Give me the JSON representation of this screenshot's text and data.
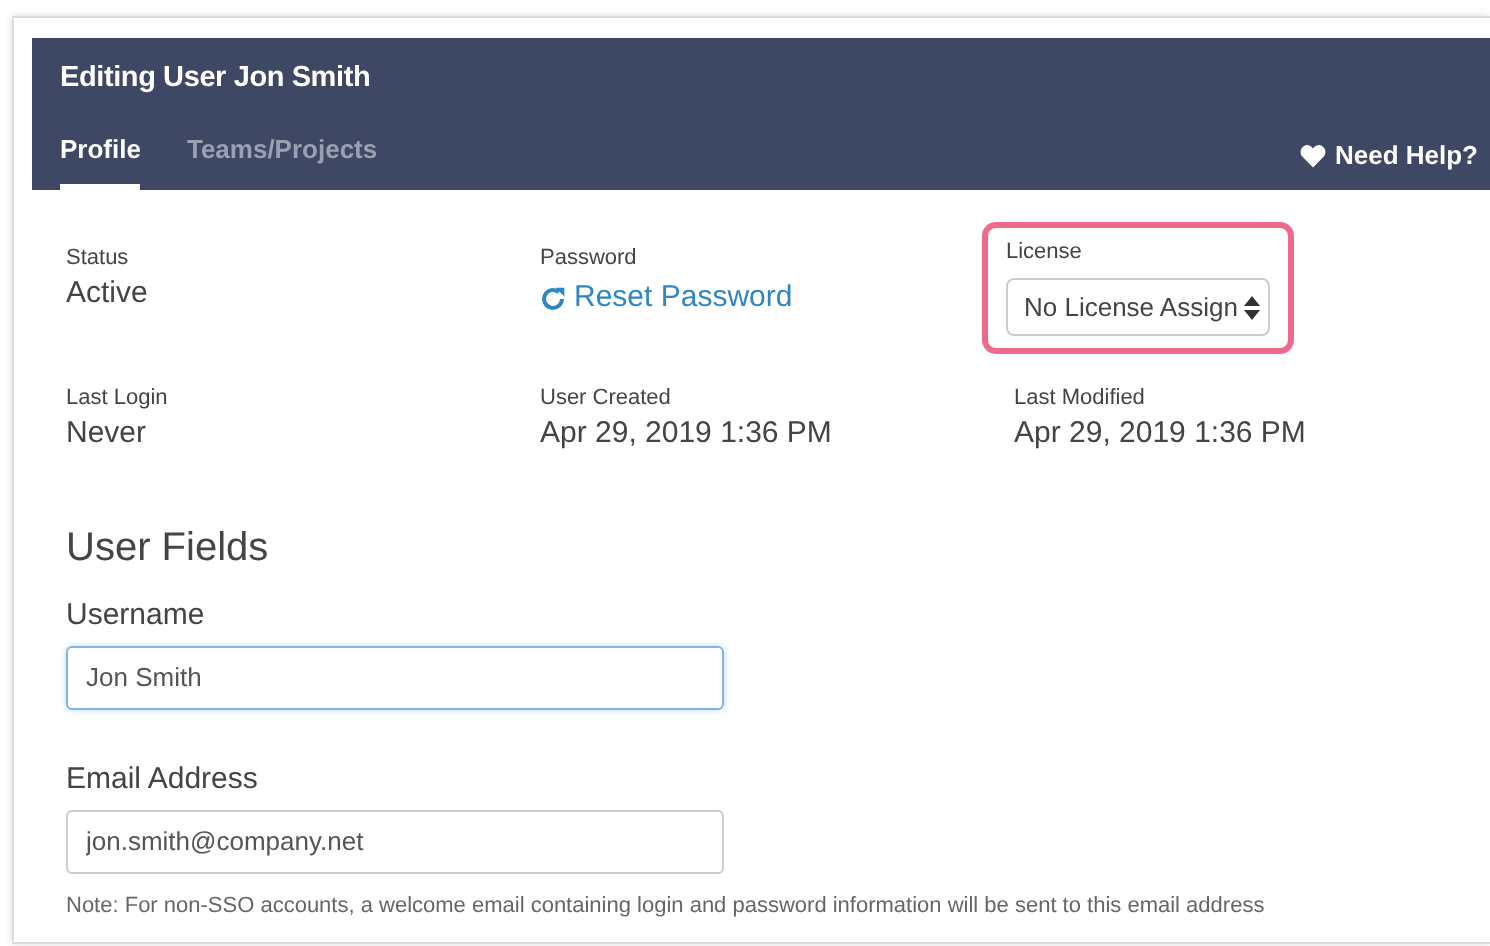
{
  "header": {
    "title": "Editing User Jon Smith",
    "tabs": [
      {
        "label": "Profile",
        "selected": true
      },
      {
        "label": "Teams/Projects",
        "selected": false
      }
    ],
    "help_link": "Need Help?"
  },
  "details": [
    {
      "label": "Status",
      "kind": "text",
      "value": "Active"
    },
    {
      "label": "Password",
      "kind": "link",
      "value": "Reset Password"
    },
    {
      "label": "License",
      "kind": "select",
      "value": "No License Assign",
      "highlighted": true
    },
    {
      "label": "Last Login",
      "kind": "text",
      "value": "Never"
    },
    {
      "label": "User Created",
      "kind": "text",
      "value": "Apr 29, 2019 1:36 PM"
    },
    {
      "label": "Last Modified",
      "kind": "text",
      "value": "Apr 29, 2019 1:36 PM"
    }
  ],
  "user_fields": {
    "heading": "User Fields",
    "fields": [
      {
        "label": "Username",
        "value": "Jon Smith",
        "focused": true
      },
      {
        "label": "Email Address",
        "value": "jon.smith@company.net",
        "focused": false,
        "note": "Note: For non-SSO accounts, a welcome email containing login and password information will be sent to this email address"
      }
    ]
  }
}
